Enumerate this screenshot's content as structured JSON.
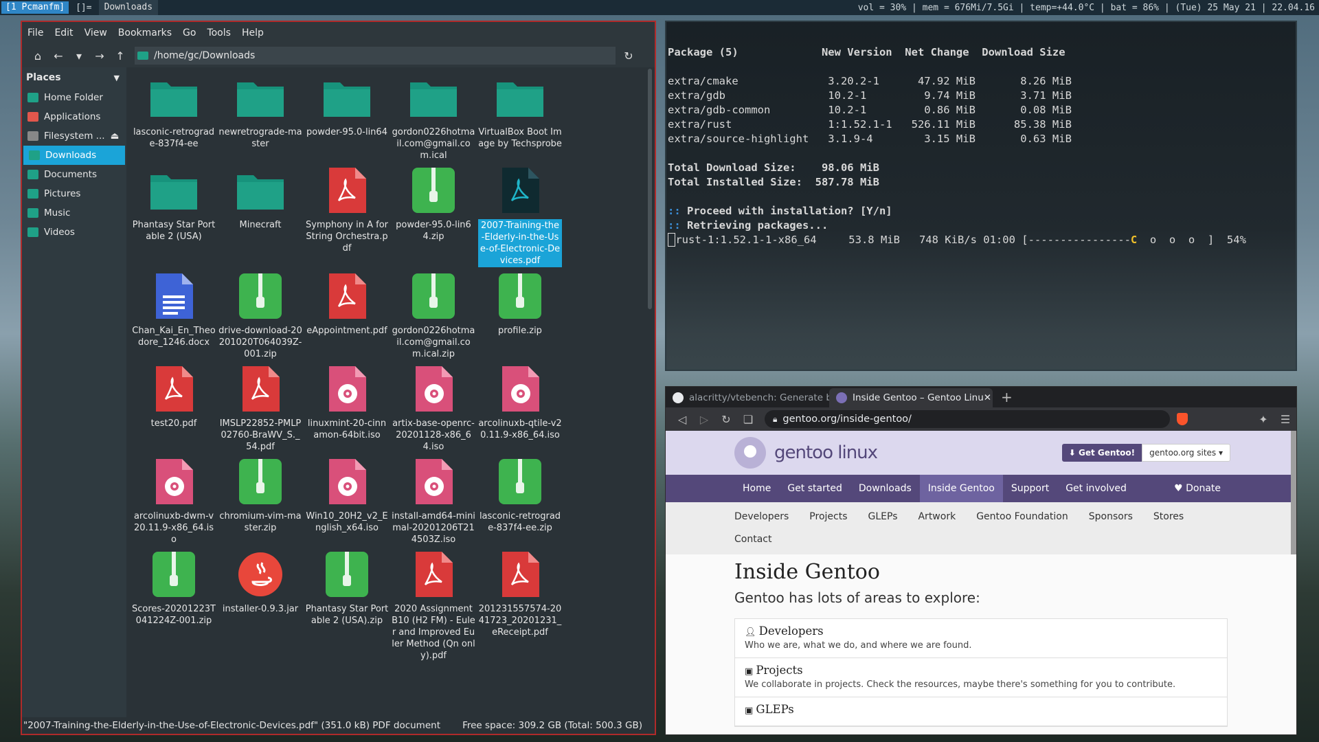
{
  "topbar": {
    "workspace": "[1 Pcmanfm]",
    "layout": "[]=",
    "title": "Downloads",
    "status": "vol = 30% | mem = 676Mi/7.5Gi | temp=+44.0°C | bat = 86% | (Tue) 25 May 21 | 22.04.16"
  },
  "filemanager": {
    "menu": [
      "File",
      "Edit",
      "View",
      "Bookmarks",
      "Go",
      "Tools",
      "Help"
    ],
    "path": "/home/gc/Downloads",
    "places_header": "Places",
    "places": [
      {
        "label": "Home Folder",
        "icon": "home-icon",
        "color": "#1fa187"
      },
      {
        "label": "Applications",
        "icon": "apps-icon",
        "color": "#e2574c"
      },
      {
        "label": "Filesystem ...",
        "icon": "drive-icon",
        "color": "#888888"
      },
      {
        "label": "Downloads",
        "icon": "folder-icon",
        "color": "#1fa187"
      },
      {
        "label": "Documents",
        "icon": "folder-icon",
        "color": "#1fa187"
      },
      {
        "label": "Pictures",
        "icon": "folder-icon",
        "color": "#1fa187"
      },
      {
        "label": "Music",
        "icon": "folder-icon",
        "color": "#1fa187"
      },
      {
        "label": "Videos",
        "icon": "folder-icon",
        "color": "#1fa187"
      }
    ],
    "files": [
      {
        "name": "lasconic-retrograde-837f4-ee",
        "type": "folder"
      },
      {
        "name": "newretrograde-master",
        "type": "folder"
      },
      {
        "name": "powder-95.0-lin64",
        "type": "folder"
      },
      {
        "name": "gordon0226hotmail.com@gmail.com.ical",
        "type": "folder"
      },
      {
        "name": "VirtualBox Boot Image by Techsprobe",
        "type": "folder"
      },
      {
        "name": "Phantasy Star Portable 2 (USA)",
        "type": "folder"
      },
      {
        "name": "Minecraft",
        "type": "folder"
      },
      {
        "name": "Symphony in A for String Orchestra.pdf",
        "type": "pdf"
      },
      {
        "name": "powder-95.0-lin64.zip",
        "type": "zip"
      },
      {
        "name": "2007-Training-the-Elderly-in-the-Use-of-Electronic-Devices.pdf",
        "type": "pdf-dark",
        "selected": true
      },
      {
        "name": "Chan_Kai_En_Theodore_1246.docx",
        "type": "doc"
      },
      {
        "name": "drive-download-20201020T064039Z-001.zip",
        "type": "zip"
      },
      {
        "name": "eAppointment.pdf",
        "type": "pdf"
      },
      {
        "name": "gordon0226hotmail.com@gmail.com.ical.zip",
        "type": "zip"
      },
      {
        "name": "profile.zip",
        "type": "zip"
      },
      {
        "name": "test20.pdf",
        "type": "pdf"
      },
      {
        "name": "IMSLP22852-PMLP02760-BraWV_S._54.pdf",
        "type": "pdf"
      },
      {
        "name": "linuxmint-20-cinnamon-64bit.iso",
        "type": "iso"
      },
      {
        "name": "artix-base-openrc-20201128-x86_64.iso",
        "type": "iso"
      },
      {
        "name": "arcolinuxb-qtile-v20.11.9-x86_64.iso",
        "type": "iso"
      },
      {
        "name": "arcolinuxb-dwm-v20.11.9-x86_64.iso",
        "type": "iso"
      },
      {
        "name": "chromium-vim-master.zip",
        "type": "zip"
      },
      {
        "name": "Win10_20H2_v2_English_x64.iso",
        "type": "iso"
      },
      {
        "name": "install-amd64-minimal-20201206T214503Z.iso",
        "type": "iso"
      },
      {
        "name": "lasconic-retrograde-837f4-ee.zip",
        "type": "zip"
      },
      {
        "name": "Scores-20201223T041224Z-001.zip",
        "type": "zip"
      },
      {
        "name": "installer-0.9.3.jar",
        "type": "jar"
      },
      {
        "name": "Phantasy Star Portable 2 (USA).zip",
        "type": "zip"
      },
      {
        "name": "2020 Assignment B10 (H2 FM) - Euler and Improved Euler Method (Qn only).pdf",
        "type": "pdf"
      },
      {
        "name": "201231557574-2041723_20201231_eReceipt.pdf",
        "type": "pdf"
      }
    ],
    "status_left": "\"2007-Training-the-Elderly-in-the-Use-of-Electronic-Devices.pdf\" (351.0 kB) PDF document",
    "status_right": "Free space: 309.2 GB (Total: 500.3 GB)"
  },
  "terminal": {
    "header": "Package (5)             New Version  Net Change  Download Size",
    "rows": [
      "extra/cmake              3.20.2-1      47.92 MiB       8.26 MiB",
      "extra/gdb                10.2-1         9.74 MiB       3.71 MiB",
      "extra/gdb-common         10.2-1         0.86 MiB       0.08 MiB",
      "extra/rust               1:1.52.1-1   526.11 MiB      85.38 MiB",
      "extra/source-highlight   3.1.9-4        3.15 MiB       0.63 MiB"
    ],
    "total_download": "Total Download Size:    98.06 MiB",
    "total_installed": "Total Installed Size:  587.78 MiB",
    "proceed": " Proceed with installation? [Y/n]",
    "retrieving": " Retrieving packages...",
    "progress_left": "rust-1:1.52.1-1-x86_64     53.8 MiB   748 KiB/s 01:00 [----------------",
    "progress_pac": "C",
    "progress_dots": "  o  o  o  ]",
    "progress_pct": "54%",
    "prompt_marker": "::"
  },
  "browser": {
    "tabs": [
      {
        "title": "alacritty/vtebench: Generate b",
        "icon": "github-icon"
      },
      {
        "title": "Inside Gentoo – Gentoo Linu",
        "icon": "gentoo-icon"
      }
    ],
    "url": "gentoo.org/inside-gentoo/",
    "page": {
      "logo_text": "gentoo linux",
      "get_btn": "⬇ Get Gentoo!",
      "sites_btn": "gentoo.org sites ▾",
      "nav": [
        "Home",
        "Get started",
        "Downloads",
        "Inside Gentoo",
        "Support",
        "Get involved"
      ],
      "donate": "♥ Donate",
      "subnav_row1": [
        "Developers",
        "Projects",
        "GLEPs",
        "Artwork",
        "Gentoo Foundation",
        "Sponsors",
        "Stores"
      ],
      "subnav_row2": [
        "Contact"
      ],
      "title": "Inside Gentoo",
      "lead": "Gentoo has lots of areas to explore:",
      "cards": [
        {
          "title": "Developers",
          "desc": "Who we are, what we do, and where we are found."
        },
        {
          "title": "Projects",
          "desc": "We collaborate in projects. Check the resources, maybe there's something for you to contribute."
        },
        {
          "title": "GLEPs",
          "desc": ""
        }
      ]
    }
  }
}
